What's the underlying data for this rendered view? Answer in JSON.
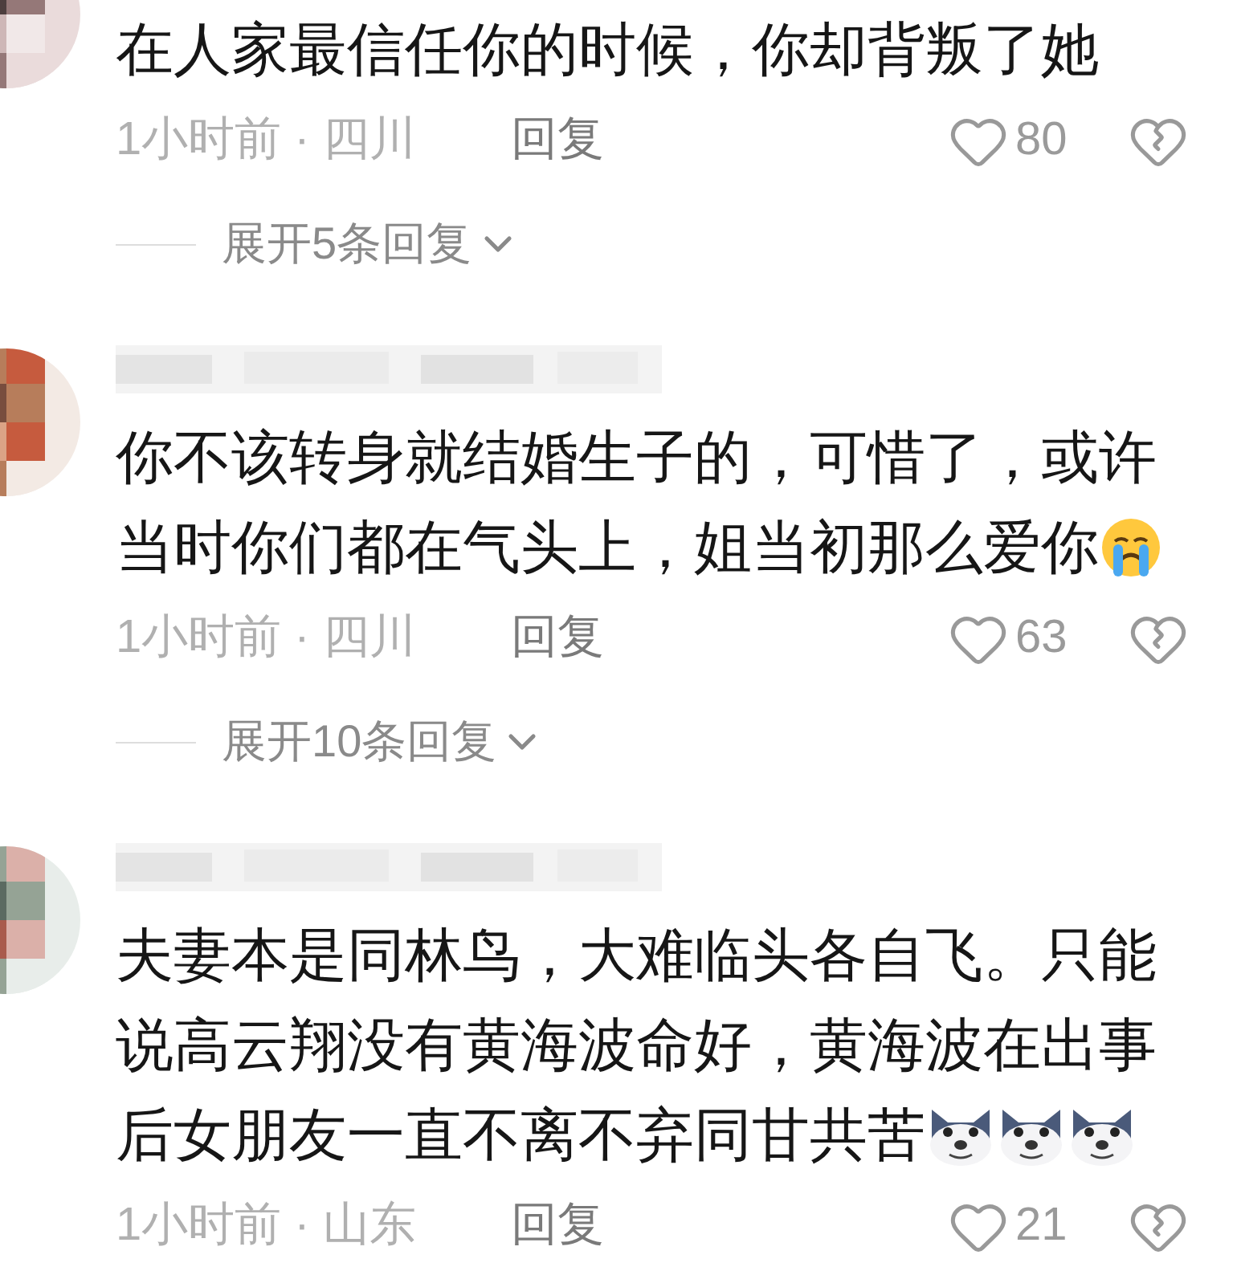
{
  "comments": [
    {
      "avatar": {
        "kind": "picture"
      },
      "name_blurred": false,
      "lines": [
        "在人家最信任你的时候，你却背叛了她"
      ],
      "time_location": "1小时前 · 四川",
      "reply": "回复",
      "likes": "80",
      "expand": "展开5条回复"
    },
    {
      "avatar": {
        "kind": "picture"
      },
      "name_blurred": true,
      "lines": [
        "你不该转身就结婚生子的，可惜了，或许",
        "当时你们都在气头上，姐当初那么爱你"
      ],
      "emojis": [
        {
          "kind": "crying"
        }
      ],
      "time_location": "1小时前 · 四川",
      "reply": "回复",
      "likes": "63",
      "expand": "展开10条回复"
    },
    {
      "avatar": {
        "kind": "picture"
      },
      "name_blurred": true,
      "lines": [
        "夫妻本是同林鸟，大难临头各自飞。只能",
        "说高云翔没有黄海波命好，黄海波在出事",
        "后女朋友一直不离不弃同甘共苦"
      ],
      "emojis": [
        {
          "kind": "wolf"
        },
        {
          "kind": "wolf"
        },
        {
          "kind": "wolf"
        }
      ],
      "time_location": "1小时前 · 山东",
      "reply": "回复",
      "likes": "21"
    }
  ]
}
